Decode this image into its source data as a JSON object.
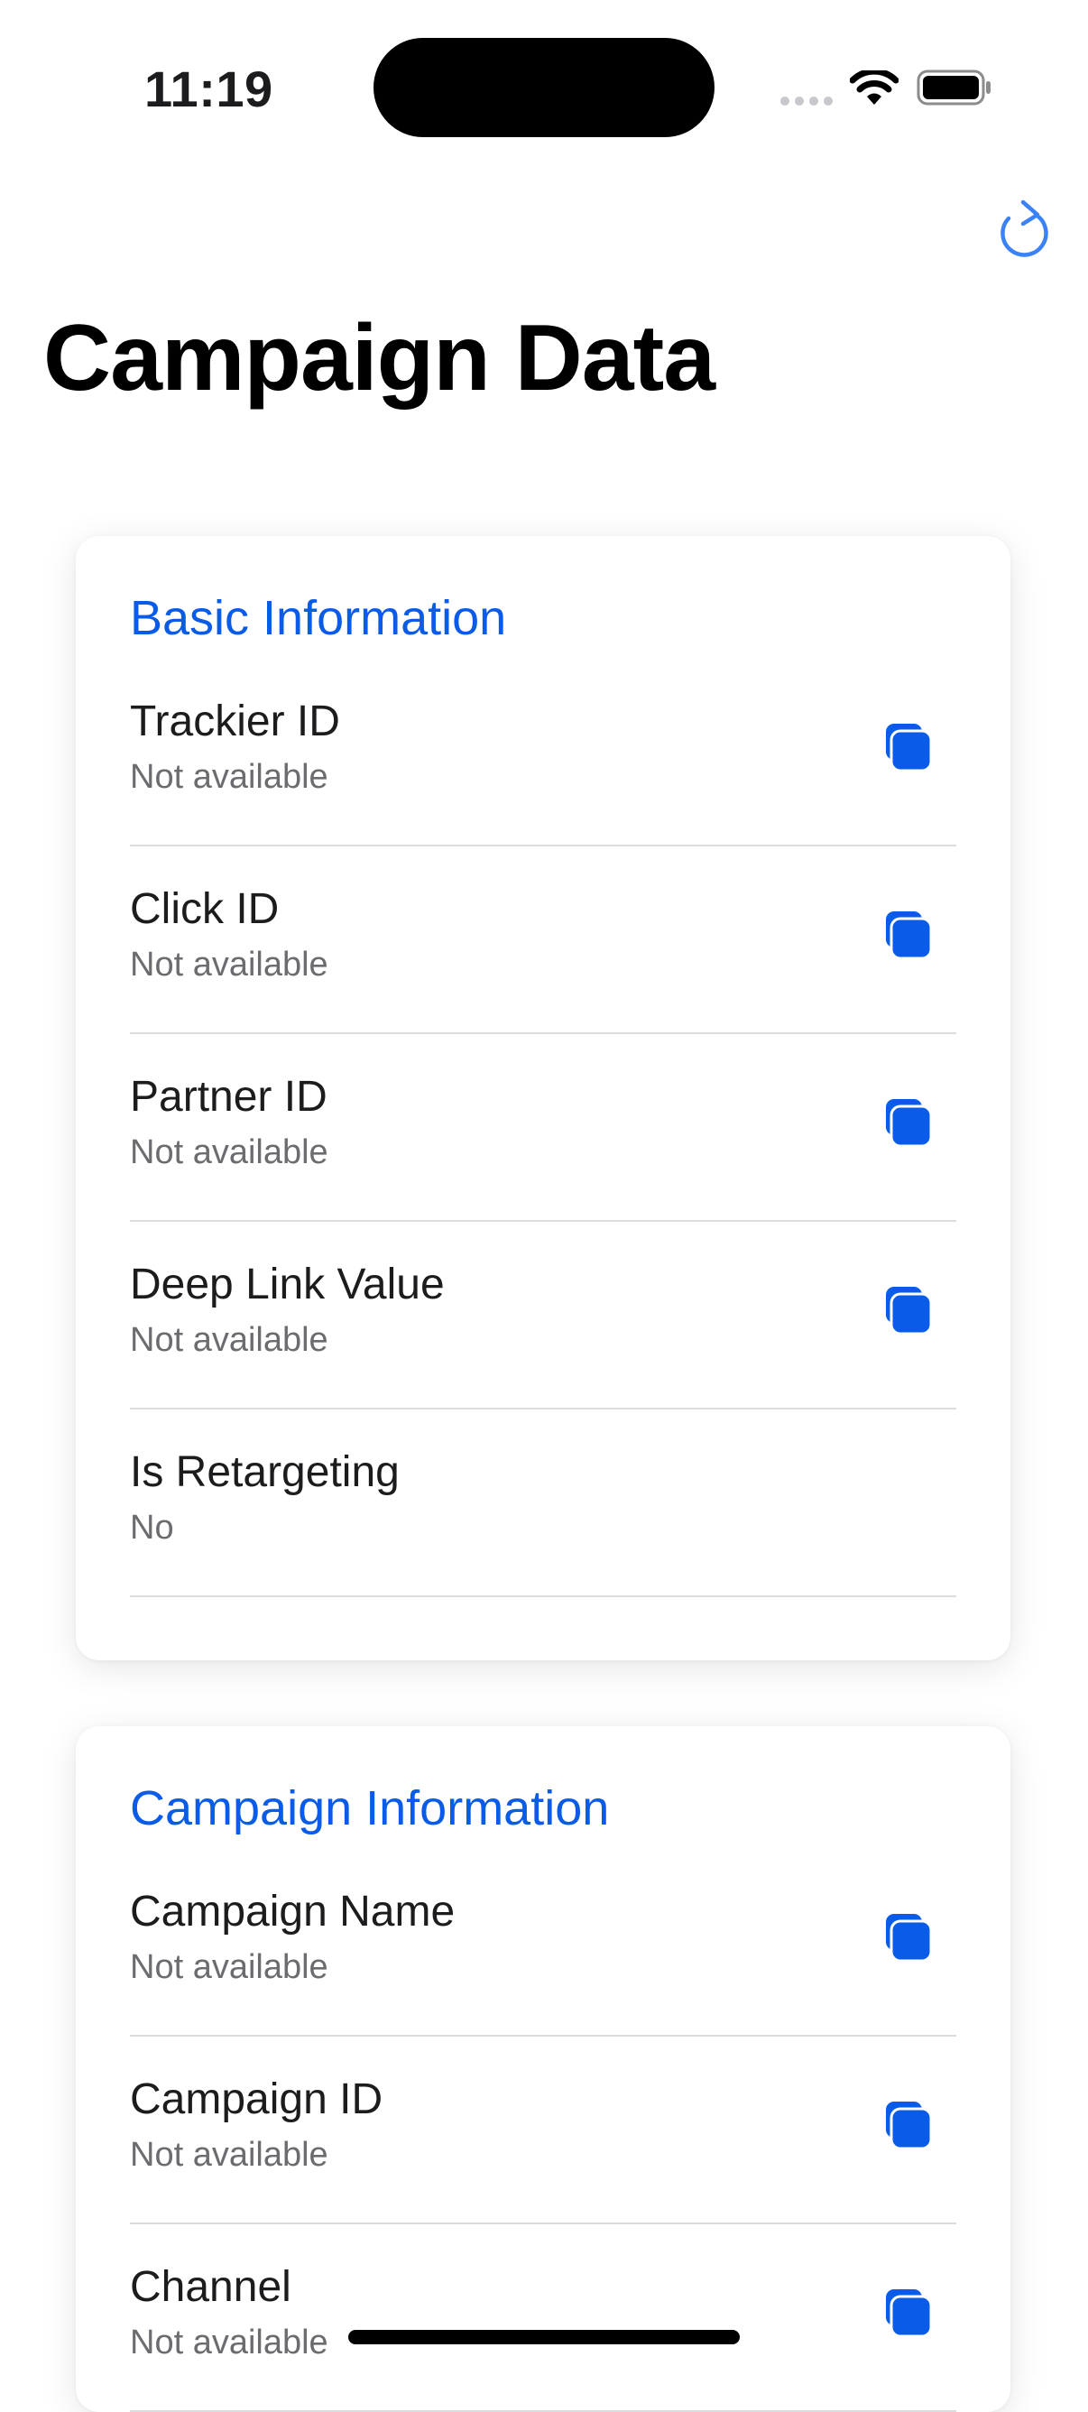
{
  "status_bar": {
    "time": "11:19"
  },
  "header": {
    "title": "Campaign Data",
    "refresh_icon": "refresh-icon"
  },
  "sections": [
    {
      "title": "Basic Information",
      "rows": [
        {
          "label": "Trackier ID",
          "value": "Not available",
          "copy": true
        },
        {
          "label": "Click ID",
          "value": "Not available",
          "copy": true
        },
        {
          "label": "Partner ID",
          "value": "Not available",
          "copy": true
        },
        {
          "label": "Deep Link Value",
          "value": "Not available",
          "copy": true
        },
        {
          "label": "Is Retargeting",
          "value": "No",
          "copy": false
        }
      ]
    },
    {
      "title": "Campaign Information",
      "rows": [
        {
          "label": "Campaign Name",
          "value": "Not available",
          "copy": true
        },
        {
          "label": "Campaign ID",
          "value": "Not available",
          "copy": true
        },
        {
          "label": "Channel",
          "value": "Not available",
          "copy": true
        }
      ]
    }
  ],
  "colors": {
    "accent": "#0a5ce8",
    "secondary_text": "#6c6c70",
    "divider": "#dcdcdf"
  }
}
